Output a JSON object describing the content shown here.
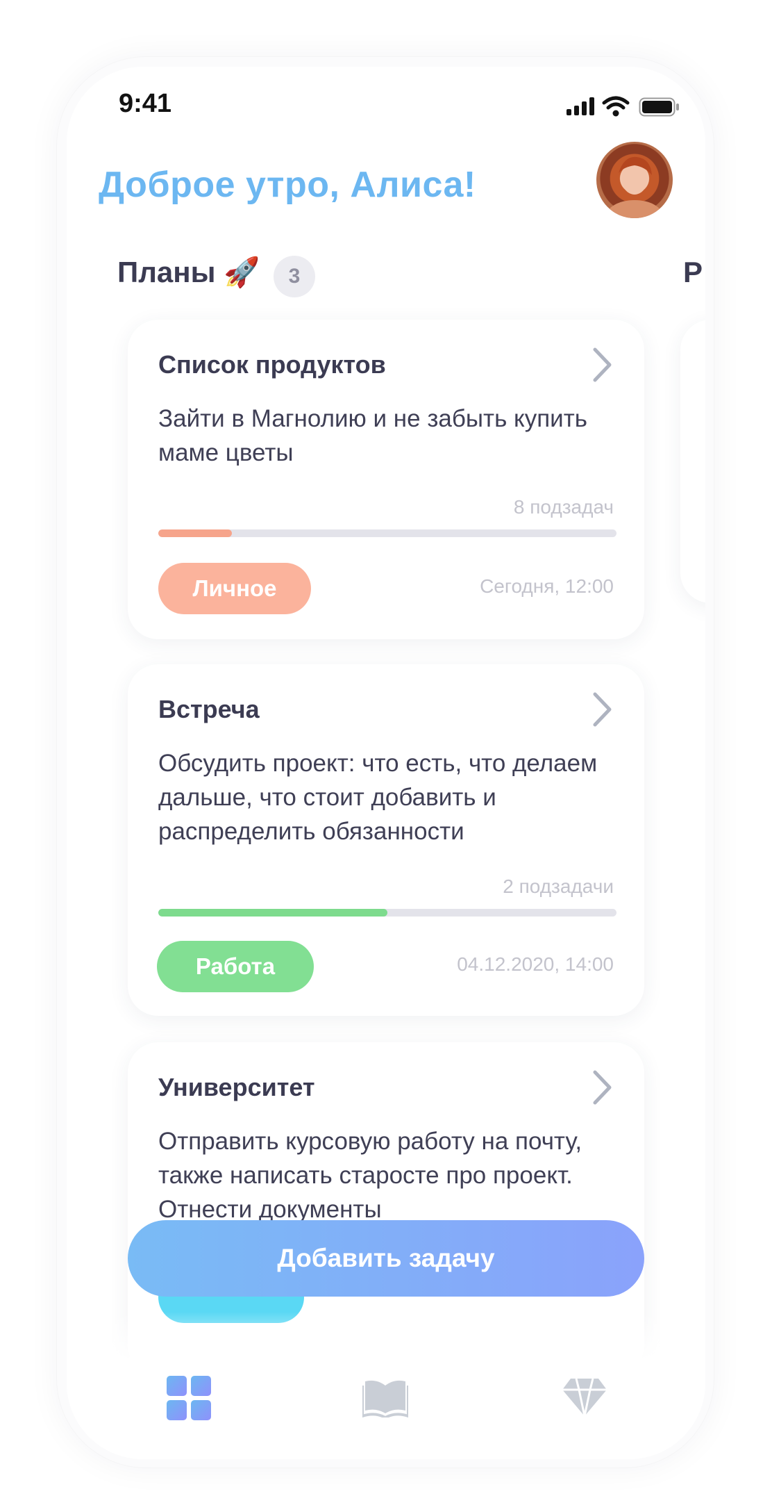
{
  "status_bar": {
    "time": "9:41"
  },
  "header": {
    "greeting": "Доброе утро, Алиса!",
    "avatar_alt": "avatar"
  },
  "section": {
    "title": "Планы 🚀",
    "count": "3",
    "next_title": "Р"
  },
  "cards": [
    {
      "title": "Список продуктов",
      "description": "Зайти в Магнолию и не забыть купить маме цветы",
      "subtasks": "8 подзадач",
      "progress": 0.16,
      "progress_color": "#f6a48b",
      "tag": "Личное",
      "tag_color": "#fbb39c",
      "due": "Сегодня, 12:00"
    },
    {
      "title": "Встреча",
      "description": "Обсудить проект: что есть, что делаем дальше, что стоит добавить и распределить обязанности",
      "subtasks": "2 подзадачи",
      "progress": 0.5,
      "progress_color": "#7ddb8d",
      "tag": "Работа",
      "tag_color": "#82df93",
      "due": "04.12.2020, 14:00"
    },
    {
      "title": "Университет",
      "description": "Отправить курсовую работу на почту, также написать старосте про проект. Отнести документы",
      "tag_color": "#5ad8f4"
    }
  ],
  "add_button": {
    "label": "Добавить задачу"
  },
  "tabbar": {
    "items": [
      {
        "icon": "dashboard-icon",
        "active": true
      },
      {
        "icon": "book-icon",
        "active": false
      },
      {
        "icon": "diamond-icon",
        "active": false
      }
    ],
    "active_color": "#8aa2fb",
    "inactive_color": "#c9ced6"
  }
}
